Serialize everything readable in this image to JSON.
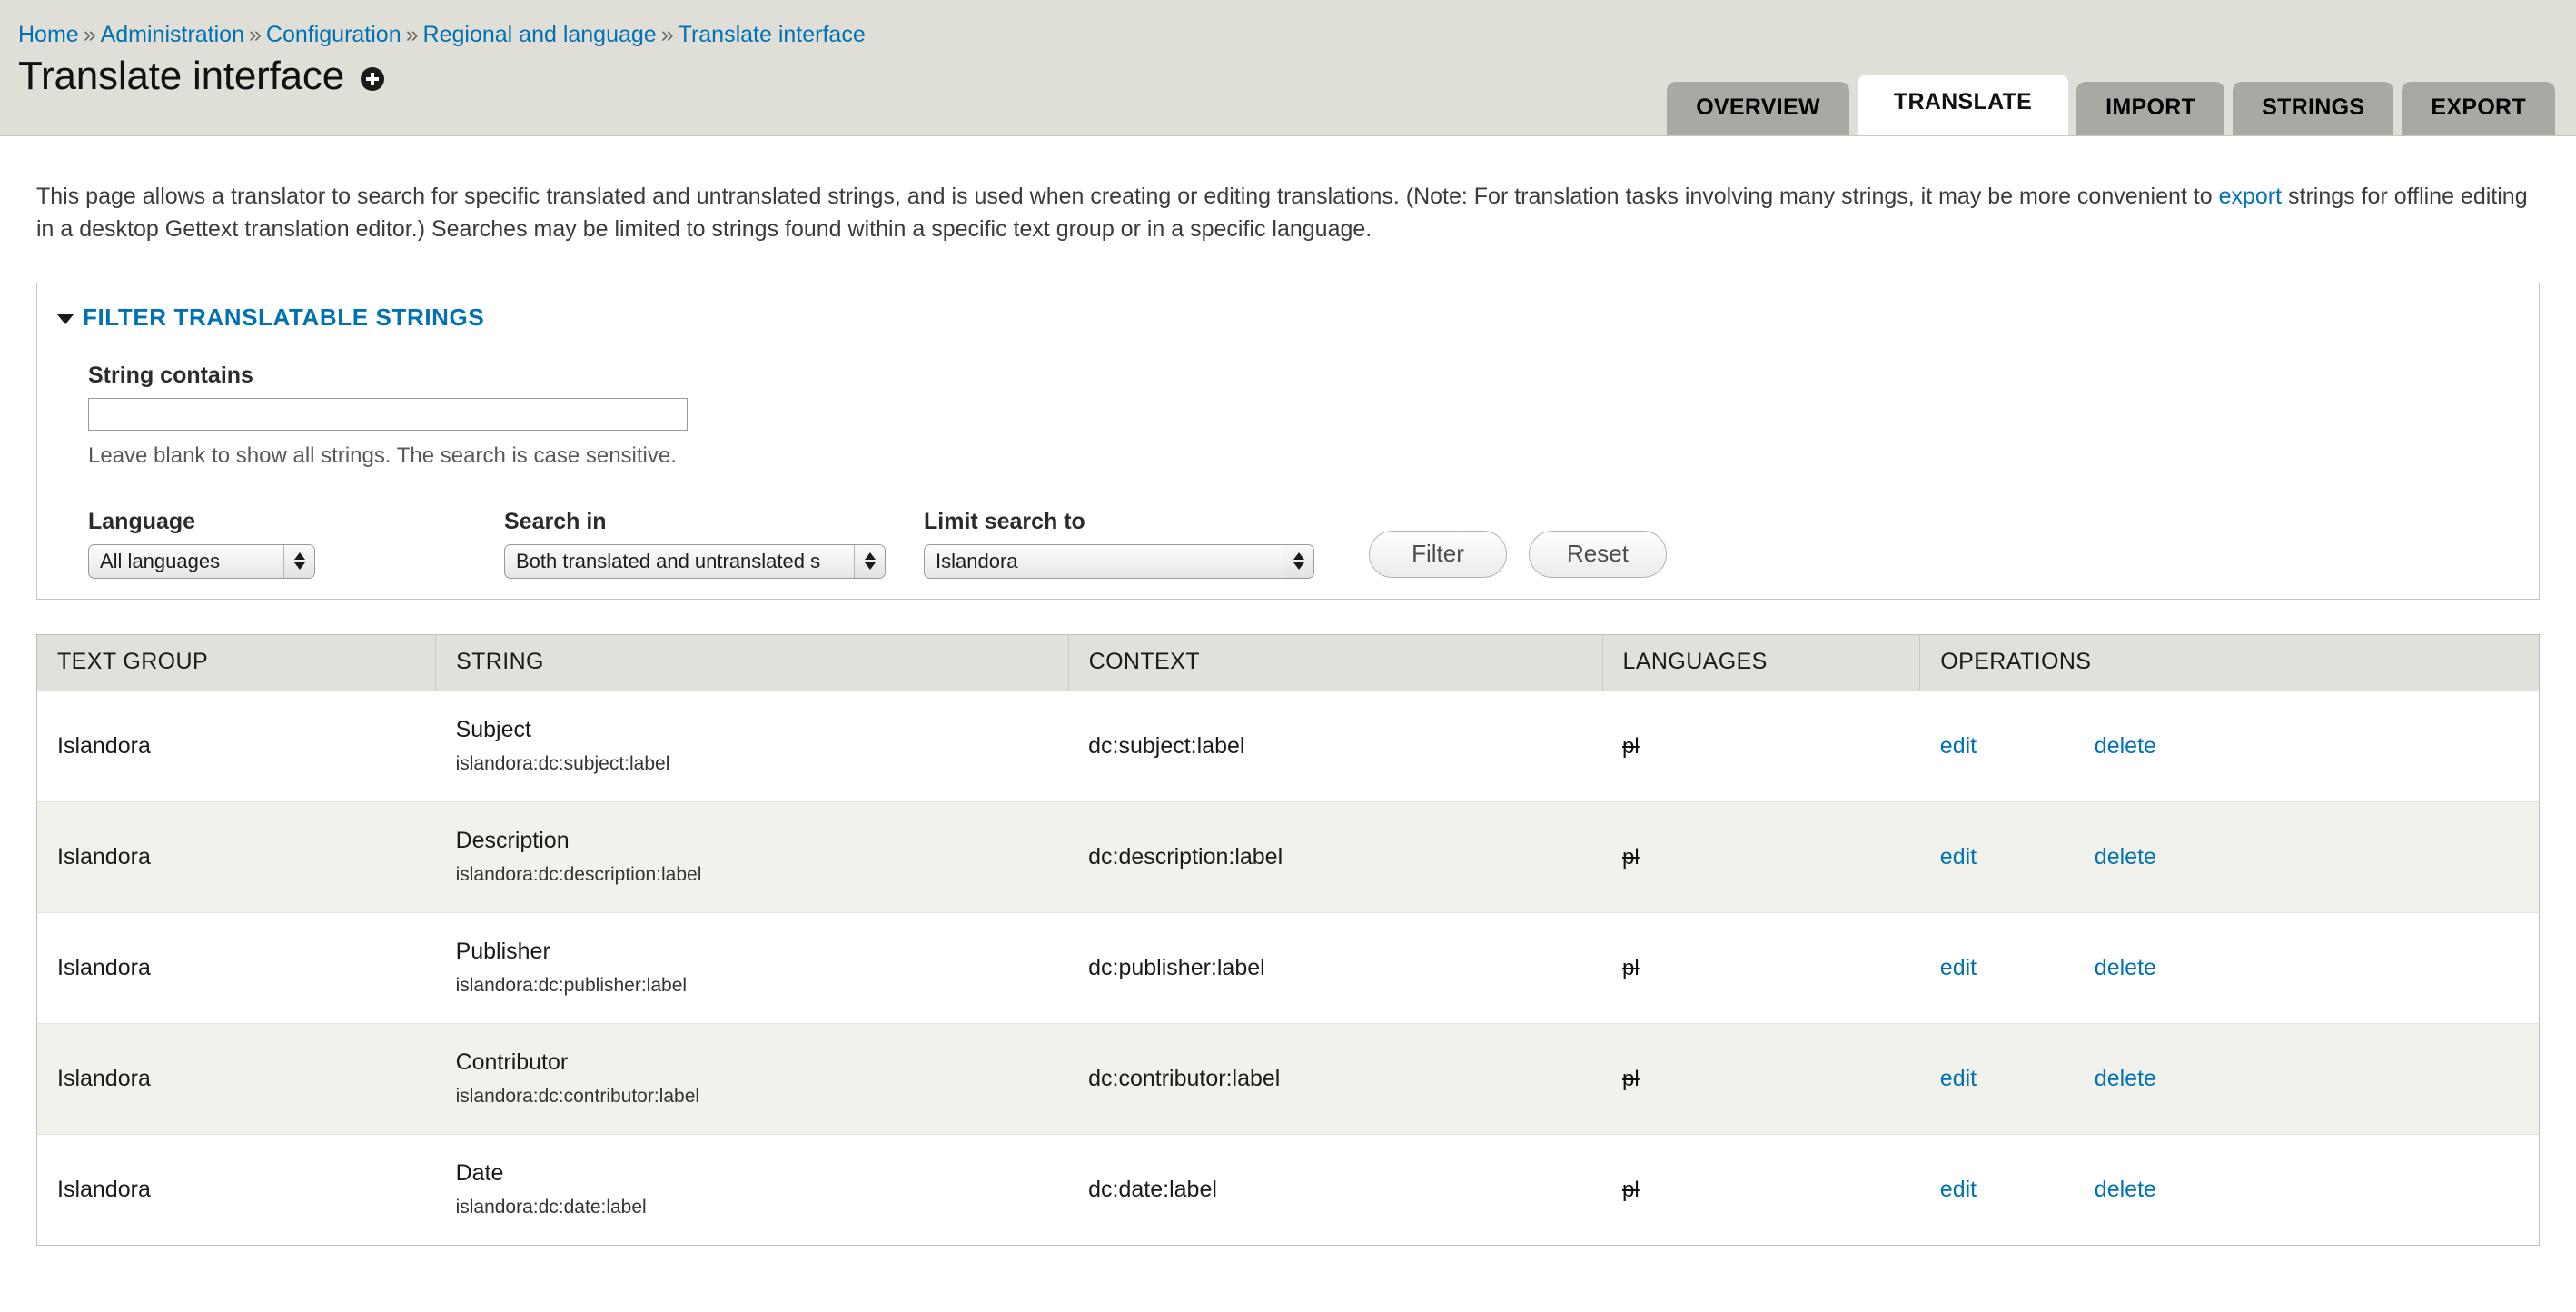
{
  "breadcrumb": {
    "separator": "»",
    "items": [
      {
        "label": "Home"
      },
      {
        "label": "Administration"
      },
      {
        "label": "Configuration"
      },
      {
        "label": "Regional and language"
      },
      {
        "label": "Translate interface"
      }
    ]
  },
  "header": {
    "title": "Translate interface",
    "add_icon": "add-circle-icon"
  },
  "tabs": [
    {
      "label": "OVERVIEW",
      "active": false
    },
    {
      "label": "TRANSLATE",
      "active": true
    },
    {
      "label": "IMPORT",
      "active": false
    },
    {
      "label": "STRINGS",
      "active": false
    },
    {
      "label": "EXPORT",
      "active": false
    }
  ],
  "intro": {
    "part1": "This page allows a translator to search for specific translated and untranslated strings, and is used when creating or editing translations. (Note: For translation tasks involving many strings, it may be more convenient to ",
    "link": "export",
    "part2": " strings for offline editing in a desktop Gettext translation editor.) Searches may be limited to strings found within a specific text group or in a specific language."
  },
  "filter": {
    "legend": "FILTER TRANSLATABLE STRINGS",
    "caret": "caret-down-icon",
    "string_contains": {
      "label": "String contains",
      "value": "",
      "placeholder": "",
      "description": "Leave blank to show all strings. The search is case sensitive."
    },
    "language": {
      "label": "Language",
      "selected": "All languages"
    },
    "search_in": {
      "label": "Search in",
      "selected": "Both translated and untranslated s"
    },
    "limit_search_to": {
      "label": "Limit search to",
      "selected": "Islandora"
    },
    "filter_button": "Filter",
    "reset_button": "Reset"
  },
  "table": {
    "columns": [
      "TEXT GROUP",
      "STRING",
      "CONTEXT",
      "LANGUAGES",
      "OPERATIONS"
    ],
    "rows": [
      {
        "text_group": "Islandora",
        "string_main": "Subject",
        "string_sub": "islandora:dc:subject:label",
        "context": "dc:subject:label",
        "languages": "pl",
        "edit": "edit",
        "delete": "delete"
      },
      {
        "text_group": "Islandora",
        "string_main": "Description",
        "string_sub": "islandora:dc:description:label",
        "context": "dc:description:label",
        "languages": "pl",
        "edit": "edit",
        "delete": "delete"
      },
      {
        "text_group": "Islandora",
        "string_main": "Publisher",
        "string_sub": "islandora:dc:publisher:label",
        "context": "dc:publisher:label",
        "languages": "pl",
        "edit": "edit",
        "delete": "delete"
      },
      {
        "text_group": "Islandora",
        "string_main": "Contributor",
        "string_sub": "islandora:dc:contributor:label",
        "context": "dc:contributor:label",
        "languages": "pl",
        "edit": "edit",
        "delete": "delete"
      },
      {
        "text_group": "Islandora",
        "string_main": "Date",
        "string_sub": "islandora:dc:date:label",
        "context": "dc:date:label",
        "languages": "pl",
        "edit": "edit",
        "delete": "delete"
      }
    ]
  },
  "colors": {
    "link": "#0071b3",
    "header_bg": "#dfdfd8",
    "tab_inactive": "#a9a9a4",
    "table_header_bg": "#e1e1db",
    "row_stripe": "#f2f2ec"
  }
}
